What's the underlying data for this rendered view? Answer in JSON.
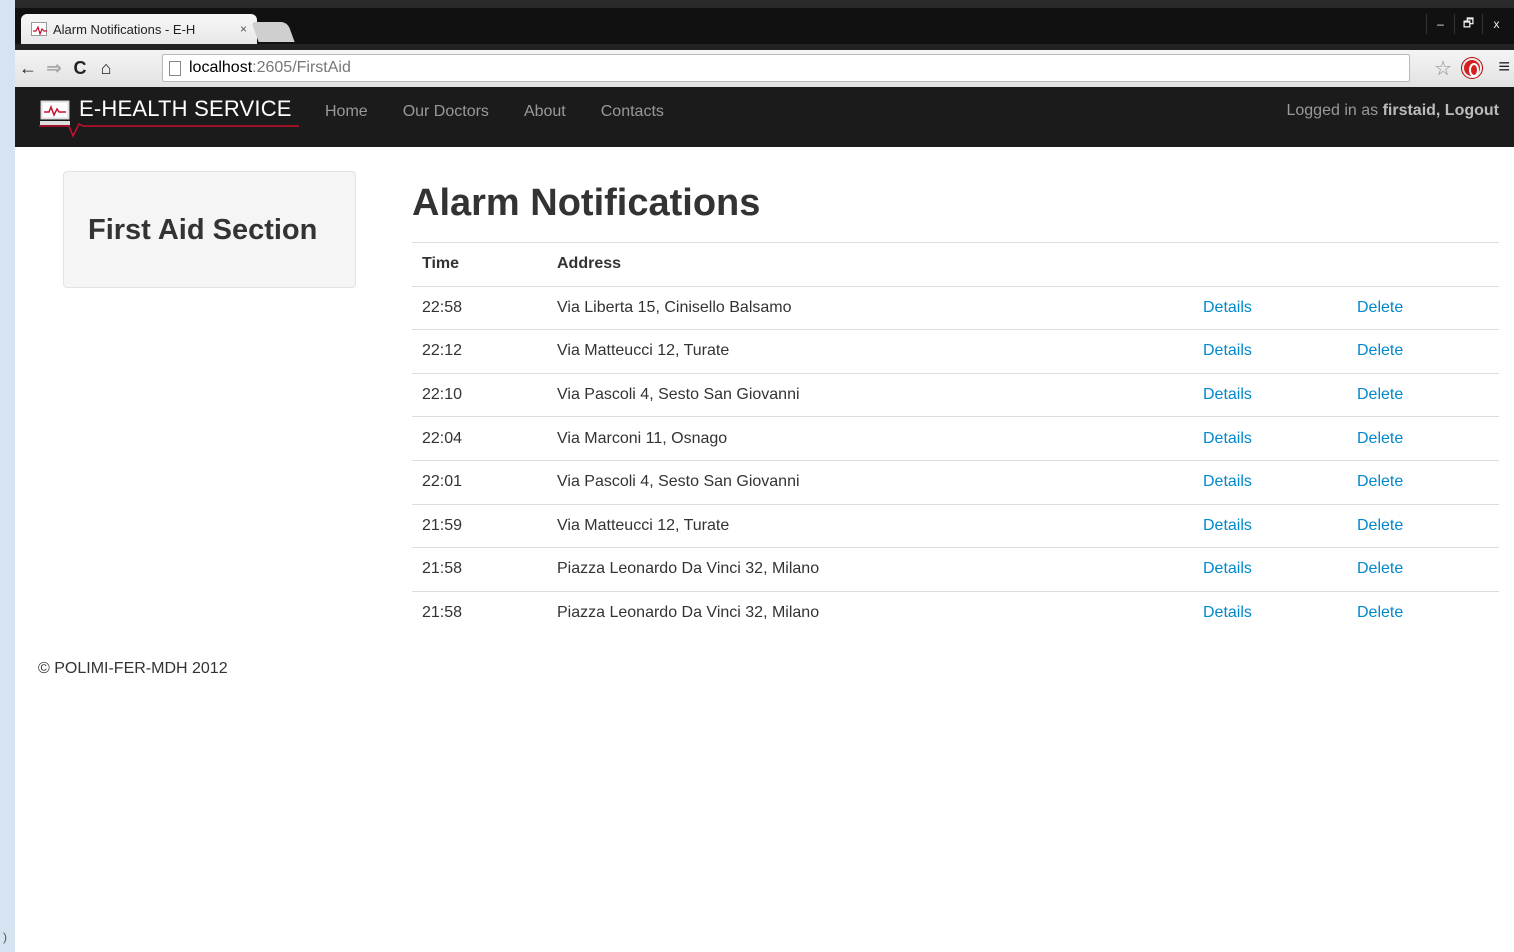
{
  "browser": {
    "tab_title": "Alarm Notifications - E-H",
    "tab_close": "×",
    "url_host": "localhost",
    "url_path": ":2605/FirstAid",
    "window_controls": [
      "–",
      "🗗",
      "x"
    ]
  },
  "navbar": {
    "brand": "E-HEALTH SERVICE",
    "links": [
      "Home",
      "Our Doctors",
      "About",
      "Contacts"
    ],
    "login_prefix": "Logged in as ",
    "login_user": "firstaid, Logout"
  },
  "sidebar": {
    "title": "First Aid Section"
  },
  "main": {
    "title": "Alarm Notifications",
    "columns": {
      "time": "Time",
      "address": "Address"
    },
    "rows": [
      {
        "time": "22:58",
        "address": "Via Liberta 15, Cinisello Balsamo",
        "details": "Details",
        "delete": "Delete"
      },
      {
        "time": "22:12",
        "address": "Via Matteucci 12, Turate",
        "details": "Details",
        "delete": "Delete"
      },
      {
        "time": "22:10",
        "address": "Via Pascoli 4, Sesto San Giovanni",
        "details": "Details",
        "delete": "Delete"
      },
      {
        "time": "22:04",
        "address": "Via Marconi 11, Osnago",
        "details": "Details",
        "delete": "Delete"
      },
      {
        "time": "22:01",
        "address": "Via Pascoli 4, Sesto San Giovanni",
        "details": "Details",
        "delete": "Delete"
      },
      {
        "time": "21:59",
        "address": "Via Matteucci 12, Turate",
        "details": "Details",
        "delete": "Delete"
      },
      {
        "time": "21:58",
        "address": "Piazza Leonardo Da Vinci 32, Milano",
        "details": "Details",
        "delete": "Delete"
      },
      {
        "time": "21:58",
        "address": "Piazza Leonardo Da Vinci 32, Milano",
        "details": "Details",
        "delete": "Delete"
      }
    ]
  },
  "footer": {
    "text": "© POLIMI-FER-MDH 2012"
  },
  "colors": {
    "link": "#0088cc",
    "navbar": "#1b1b1b",
    "brand_accent": "#c8102e"
  }
}
